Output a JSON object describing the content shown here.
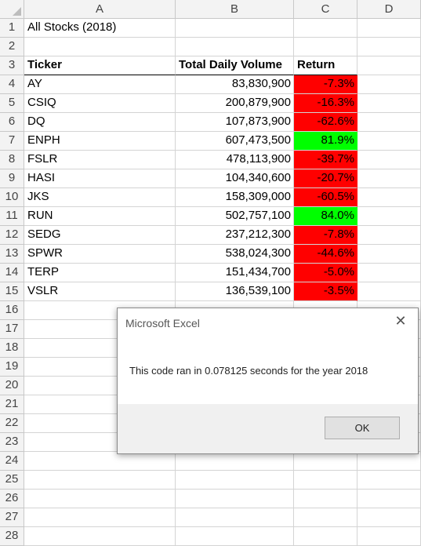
{
  "columns": [
    "A",
    "B",
    "C",
    "D"
  ],
  "rows": [
    "1",
    "2",
    "3",
    "4",
    "5",
    "6",
    "7",
    "8",
    "9",
    "10",
    "11",
    "12",
    "13",
    "14",
    "15",
    "16",
    "17",
    "18",
    "19",
    "20",
    "21",
    "22",
    "23",
    "24",
    "25",
    "26",
    "27",
    "28"
  ],
  "sheet": {
    "title": "All Stocks (2018)",
    "headers": {
      "ticker": "Ticker",
      "volume": "Total Daily Volume",
      "return": "Return"
    },
    "stocks": [
      {
        "ticker": "AY",
        "volume": "83,830,900",
        "return": "-7.3%",
        "color": "#ff0000"
      },
      {
        "ticker": "CSIQ",
        "volume": "200,879,900",
        "return": "-16.3%",
        "color": "#ff0000"
      },
      {
        "ticker": "DQ",
        "volume": "107,873,900",
        "return": "-62.6%",
        "color": "#ff0000"
      },
      {
        "ticker": "ENPH",
        "volume": "607,473,500",
        "return": "81.9%",
        "color": "#00ff00"
      },
      {
        "ticker": "FSLR",
        "volume": "478,113,900",
        "return": "-39.7%",
        "color": "#ff0000"
      },
      {
        "ticker": "HASI",
        "volume": "104,340,600",
        "return": "-20.7%",
        "color": "#ff0000"
      },
      {
        "ticker": "JKS",
        "volume": "158,309,000",
        "return": "-60.5%",
        "color": "#ff0000"
      },
      {
        "ticker": "RUN",
        "volume": "502,757,100",
        "return": "84.0%",
        "color": "#00ff00"
      },
      {
        "ticker": "SEDG",
        "volume": "237,212,300",
        "return": "-7.8%",
        "color": "#ff0000"
      },
      {
        "ticker": "SPWR",
        "volume": "538,024,300",
        "return": "-44.6%",
        "color": "#ff0000"
      },
      {
        "ticker": "TERP",
        "volume": "151,434,700",
        "return": "-5.0%",
        "color": "#ff0000"
      },
      {
        "ticker": "VSLR",
        "volume": "136,539,100",
        "return": "-3.5%",
        "color": "#ff0000"
      }
    ]
  },
  "dialog": {
    "title": "Microsoft Excel",
    "message": "This code ran in 0.078125 seconds for the year 2018",
    "ok_label": "OK",
    "close_icon": "close-icon"
  }
}
